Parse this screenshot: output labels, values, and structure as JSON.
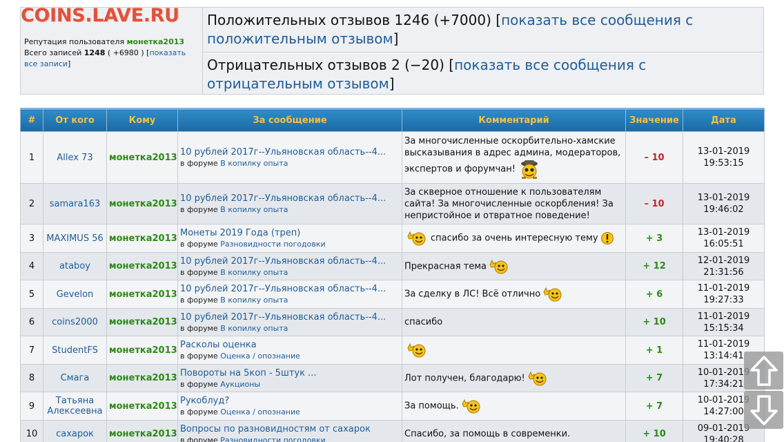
{
  "site": {
    "logo": "COINS.LAVE.RU"
  },
  "reputation": {
    "label": "Репутация пользователя",
    "user": "монетка2013",
    "total_label": "Всего записей",
    "total_count": "1248",
    "total_rest": " ( +6980 ) [",
    "show_all": "показать все записи",
    "close_bracket": "]"
  },
  "summary": {
    "positive_text": "Положительных отзывов 1246 (+7000) [",
    "positive_link": "показать все сообщения с положительным отзывом",
    "negative_text": "Отрицательных отзывов 2 (−20) [",
    "negative_link": "показать все сообщения с отрицательным отзывом",
    "close_bracket": "]"
  },
  "table": {
    "headers": [
      "#",
      "От кого",
      "Кому",
      "За сообщение",
      "Комментарий",
      "Значение",
      "Дата"
    ],
    "forum_prefix": "в форуме",
    "rows": [
      {
        "num": "1",
        "from": "Allex 73",
        "to": "монетка2013",
        "msg": "10 рублей 2017г--Ульяновская область--4...",
        "forum": "В копилку опыта",
        "comment": "За многочисленные оскорбительно-хамские высказывания в адрес админа, модераторов, экспертов и форумчан!",
        "value": "– 10",
        "sign": "neg",
        "date1": "13-01-2019",
        "date2": "19:53:15"
      },
      {
        "num": "2",
        "from": "samara163",
        "to": "монетка2013",
        "msg": "10 рублей 2017г--Ульяновская область--4...",
        "forum": "В копилку опыта",
        "comment": "За скверное отношение к пользователям сайта! За многочисленные оскорбления! За непристойное и отвратное поведение!",
        "value": "– 10",
        "sign": "neg",
        "date1": "13-01-2019",
        "date2": "19:46:02"
      },
      {
        "num": "3",
        "from": "MAXIMUS 56",
        "to": "монетка2013",
        "msg": "Монеты 2019 Года (треп)",
        "forum": "Разновидности погодовки",
        "comment": "спасибо за очень интересную тему",
        "value": "+ 3",
        "sign": "pos",
        "date1": "13-01-2019",
        "date2": "16:05:51"
      },
      {
        "num": "4",
        "from": "ataboy",
        "to": "монетка2013",
        "msg": "10 рублей 2017г--Ульяновская область--4...",
        "forum": "В копилку опыта",
        "comment": "Прекрасная тема",
        "value": "+ 12",
        "sign": "pos",
        "date1": "12-01-2019",
        "date2": "21:31:56"
      },
      {
        "num": "5",
        "from": "Gevelon",
        "to": "монетка2013",
        "msg": "10 рублей 2017г--Ульяновская область--4...",
        "forum": "В копилку опыта",
        "comment": "За сделку в ЛС! Всё отлично",
        "value": "+ 6",
        "sign": "pos",
        "date1": "11-01-2019",
        "date2": "19:27:33"
      },
      {
        "num": "6",
        "from": "coins2000",
        "to": "монетка2013",
        "msg": "10 рублей 2017г--Ульяновская область--4...",
        "forum": "В копилку опыта",
        "comment": "спасибо",
        "value": "+ 10",
        "sign": "pos",
        "date1": "11-01-2019",
        "date2": "15:15:34"
      },
      {
        "num": "7",
        "from": "StudentFS",
        "to": "монетка2013",
        "msg": "Расколы оценка",
        "forum": "Оценка / опознание",
        "comment": "",
        "value": "+ 1",
        "sign": "pos",
        "date1": "11-01-2019",
        "date2": "13:14:41"
      },
      {
        "num": "8",
        "from": "Смага",
        "to": "монетка2013",
        "msg": "Повороты на 5коп - 5штук ...",
        "forum": "Аукционы",
        "comment": "Лот получен, благодарю!",
        "value": "+ 7",
        "sign": "pos",
        "date1": "10-01-2019",
        "date2": "17:34:21"
      },
      {
        "num": "9",
        "from": "Татьяна Алексеевна",
        "to": "монетка2013",
        "msg": "Рукоблуд?",
        "forum": "Оценка / опознание",
        "comment": "За помощь.",
        "value": "+ 7",
        "sign": "pos",
        "date1": "10-01-2019",
        "date2": "14:27:00"
      },
      {
        "num": "10",
        "from": "сахарок",
        "to": "монетка2013",
        "msg": "Вопросы по разновидностям от сахарок",
        "forum": "Разновидности погодовки",
        "comment": "Спасибо, за помощь в современки.",
        "value": "+ 10",
        "sign": "pos",
        "date1": "09-01-2019",
        "date2": "19:40:28"
      }
    ]
  },
  "icons": {
    "smile": "thumbs-up-smiley-icon",
    "detective": "detective-smiley-icon",
    "exclaim": "exclamation-smiley-icon",
    "scroll_up": "scroll-up-arrow-icon",
    "scroll_down": "scroll-down-arrow-icon"
  },
  "colors": {
    "header_bg": "#1a6aa6",
    "header_text": "#f6c244",
    "positive": "#2c8a16",
    "negative": "#c8202a",
    "link": "#1f5c99",
    "logo": "#e0523c"
  }
}
